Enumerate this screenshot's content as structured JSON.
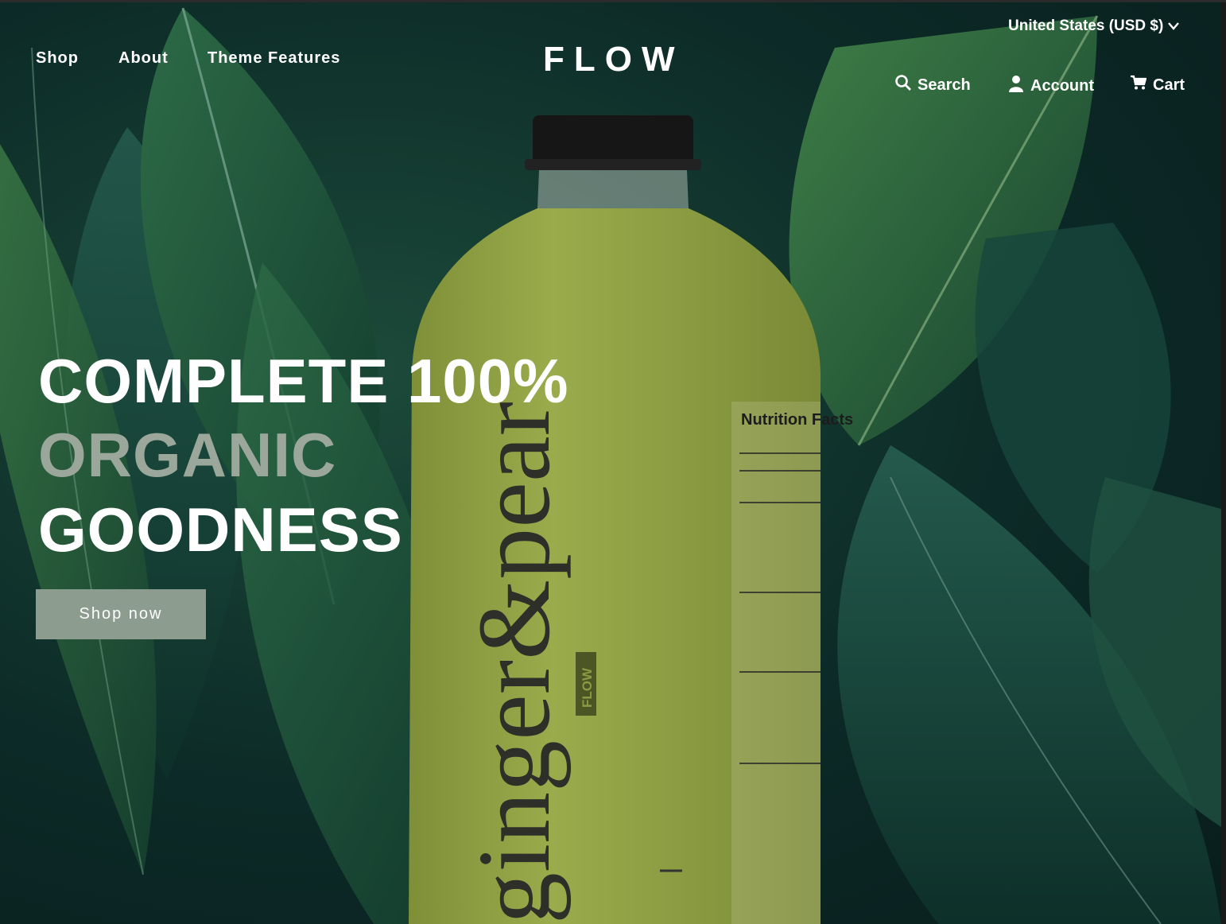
{
  "nav": {
    "items": [
      {
        "label": "Shop"
      },
      {
        "label": "About"
      },
      {
        "label": "Theme Features"
      }
    ]
  },
  "brand": {
    "logo": "FLOW"
  },
  "header": {
    "currency": "United States (USD $)",
    "search_label": "Search",
    "account_label": "Account",
    "cart_label": "Cart"
  },
  "hero": {
    "line1": "COMPLETE 100%",
    "line2": "ORGANIC",
    "line3": "GOODNESS",
    "cta": "Shop now",
    "bottle_brand": "ginger&pear",
    "bottle_tag": "FLOW",
    "label_title": "Nutrition Facts"
  },
  "colors": {
    "accent": "#8c9c8e",
    "headline_muted": "#9aa79a",
    "bottle": "#8a9a43"
  },
  "icons": [
    "chevron-down-icon",
    "search-icon",
    "account-icon",
    "cart-icon"
  ]
}
